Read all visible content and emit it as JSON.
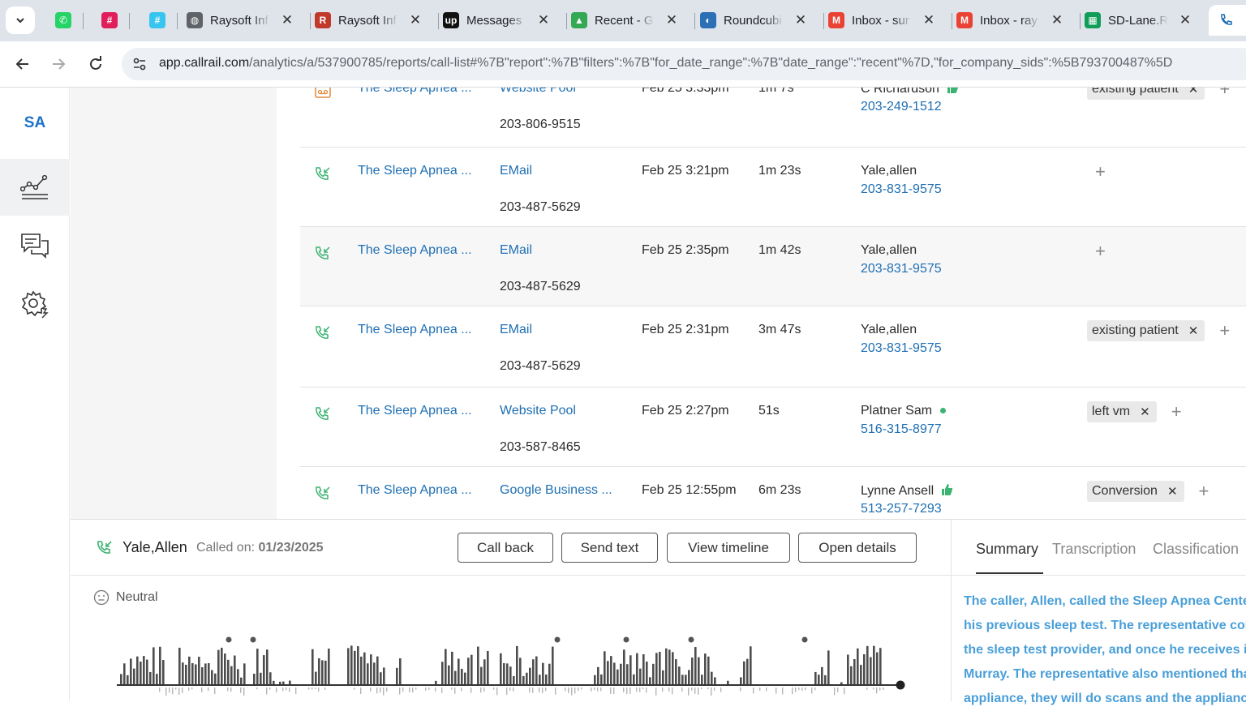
{
  "browser": {
    "tabs": [
      {
        "label": "",
        "icon": "whatsapp-icon",
        "color": "#25d366"
      },
      {
        "label": "",
        "icon": "slack-icon",
        "color": "#e01e5a"
      },
      {
        "label": "",
        "icon": "slack-icon",
        "color": "#36c5f0"
      },
      {
        "label": "Raysoft Inf",
        "icon": "globe-icon",
        "color": "#5f6368"
      },
      {
        "label": "Raysoft Inf",
        "icon": "raysoft-icon",
        "color": "#c0392b"
      },
      {
        "label": "Messages",
        "icon": "upwork-icon",
        "color": "#111111"
      },
      {
        "label": "Recent - G",
        "icon": "google-drive-icon",
        "color": "#34a853"
      },
      {
        "label": "Roundcubi",
        "icon": "roundcube-icon",
        "color": "#2c6fb5"
      },
      {
        "label": "Inbox - sur",
        "icon": "gmail-icon",
        "color": "#ea4335"
      },
      {
        "label": "Inbox - ray",
        "icon": "gmail-icon",
        "color": "#ea4335"
      },
      {
        "label": "SD-Lane.R",
        "icon": "google-sheets-icon",
        "color": "#0f9d58"
      }
    ],
    "close_glyph": "✕",
    "url_host": "app.callrail.com",
    "url_path": "/analytics/a/537900785/reports/call-list#%7B\"report\":%7B\"filters\":%7B\"for_date_range\":%7B\"date_range\":\"recent\"%7D,\"for_company_sids\":%5B793700487%5D"
  },
  "sidebar": {
    "logo": "SA",
    "items": [
      {
        "icon": "analytics-icon",
        "active": true
      },
      {
        "icon": "chat-icon",
        "active": false
      },
      {
        "icon": "settings-icon",
        "active": false
      }
    ]
  },
  "calls": [
    {
      "company": "The Sleep Apnea ...",
      "source": "Website Pool",
      "tracking": "203-806-9515",
      "date": "Feb 25 3:33pm",
      "duration": "1m 7s",
      "caller": "C Richardson",
      "caller_phone": "203-249-1512",
      "tags": [
        "existing patient"
      ],
      "indicator": "thumb",
      "icon": "voicemail-icon"
    },
    {
      "company": "The Sleep Apnea ...",
      "source": "EMail",
      "tracking": "203-487-5629",
      "date": "Feb 25 3:21pm",
      "duration": "1m 23s",
      "caller": "Yale,allen",
      "caller_phone": "203-831-9575",
      "tags": [],
      "indicator": "",
      "icon": "inbound-call-icon"
    },
    {
      "company": "The Sleep Apnea ...",
      "source": "EMail",
      "tracking": "203-487-5629",
      "date": "Feb 25 2:35pm",
      "duration": "1m 42s",
      "caller": "Yale,allen",
      "caller_phone": "203-831-9575",
      "tags": [],
      "indicator": "",
      "icon": "inbound-call-icon"
    },
    {
      "company": "The Sleep Apnea ...",
      "source": "EMail",
      "tracking": "203-487-5629",
      "date": "Feb 25 2:31pm",
      "duration": "3m 47s",
      "caller": "Yale,allen",
      "caller_phone": "203-831-9575",
      "tags": [
        "existing patient"
      ],
      "indicator": "",
      "icon": "inbound-call-icon"
    },
    {
      "company": "The Sleep Apnea ...",
      "source": "Website Pool",
      "tracking": "203-587-8465",
      "date": "Feb 25 2:27pm",
      "duration": "51s",
      "caller": "Platner Sam",
      "caller_phone": "516-315-8977",
      "tags": [
        "left vm"
      ],
      "indicator": "dot",
      "icon": "inbound-call-icon"
    },
    {
      "company": "The Sleep Apnea ...",
      "source": "Google Business ...",
      "tracking": "",
      "date": "Feb 25 12:55pm",
      "duration": "6m 23s",
      "caller": "Lynne Ansell",
      "caller_phone": "513-257-7293",
      "tags": [
        "Conversion"
      ],
      "indicator": "thumb",
      "icon": "inbound-call-icon"
    }
  ],
  "panel": {
    "caller_name": "Yale,Allen",
    "called_on_label": "Called on:",
    "called_on_date": "01/23/2025",
    "buttons": [
      "Call back",
      "Send text",
      "View timeline",
      "Open details"
    ],
    "sentiment": "Neutral",
    "tabs": [
      "Summary",
      "Transcription",
      "Classification"
    ],
    "active_tab": "Summary",
    "summary_lines": [
      "The caller, Allen, called the Sleep Apnea Center",
      "his previous sleep test. The representative con",
      "the sleep test provider, and once he receives it,",
      "Murray. The representative also mentioned tha",
      "appliance, they will do scans and the appliance"
    ]
  },
  "colors": {
    "accent": "#1f6fb2",
    "positive": "#3cb371",
    "summary_text": "#4a9fd8"
  }
}
